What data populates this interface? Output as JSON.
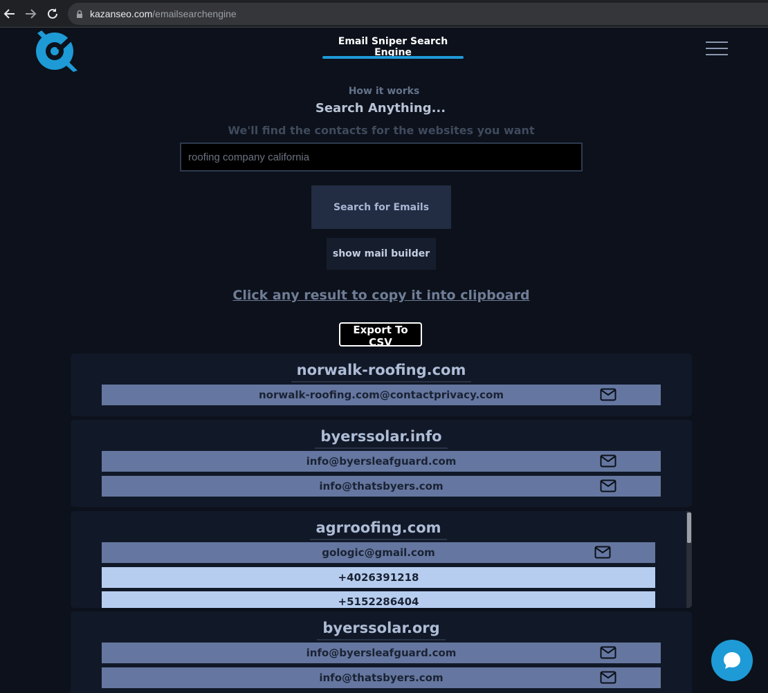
{
  "browser": {
    "url_host": "kazanseo.com",
    "url_path": "/emailsearchengine"
  },
  "header": {
    "title": "Email Sniper Search Engine"
  },
  "hero": {
    "how_it_works": "How it works",
    "search_anything": "Search Anything...",
    "subtitle": "We'll find the contacts for the websites you want"
  },
  "search": {
    "value": "roofing company california",
    "button_label": "Search for Emails",
    "builder_label": "show mail builder"
  },
  "clipboard_hint": "Click any result to copy it into clipboard",
  "export_label": "Export To CSV",
  "results": [
    {
      "domain": "norwalk-roofing.com",
      "emails": [
        "norwalk-roofing.com@contactprivacy.com"
      ],
      "phones": []
    },
    {
      "domain": "byerssolar.info",
      "emails": [
        "info@byersleafguard.com",
        "info@thatsbyers.com"
      ],
      "phones": []
    },
    {
      "domain": "agrroofing.com",
      "emails": [
        "gologic@gmail.com"
      ],
      "phones": [
        "+4026391218",
        "+5152286404"
      ]
    },
    {
      "domain": "byerssolar.org",
      "emails": [
        "info@byersleafguard.com",
        "info@thatsbyers.com"
      ],
      "phones": []
    }
  ],
  "icons": {
    "back": "arrow-left-icon",
    "forward": "arrow-right-icon",
    "reload": "reload-icon",
    "lock": "lock-icon",
    "menu": "hamburger-menu-icon",
    "mail": "mail-icon",
    "chat": "chat-bubble-icon"
  },
  "colors": {
    "accent": "#1e9ad6",
    "email_row": "#6577a0",
    "phone_row": "#b6cdef"
  }
}
